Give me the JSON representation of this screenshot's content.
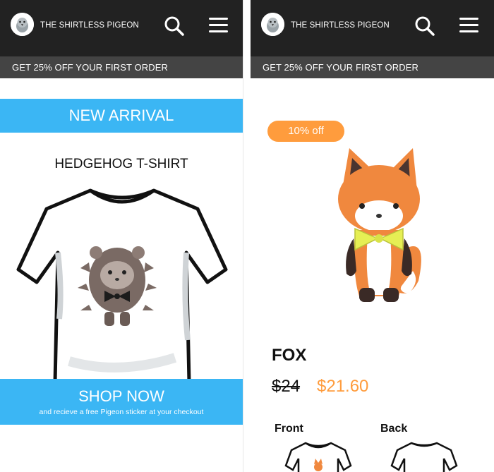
{
  "header": {
    "brand_name": "THE SHIRTLESS PIGEON",
    "search_icon": "search-icon",
    "menu_icon": "hamburger-menu-icon"
  },
  "promo": {
    "text": "GET 25% OFF YOUR FIRST ORDER"
  },
  "home": {
    "banner_label": "NEW ARRIVAL",
    "product_title": "HEDGEHOG T-SHIRT",
    "shop_label": "SHOP NOW",
    "shop_subtext": "and recieve a free Pigeon sticker at your checkout"
  },
  "product": {
    "discount_badge": "10% off",
    "name": "FOX",
    "old_price": "$24",
    "new_price": "$21.60",
    "views": [
      "Front",
      "Back"
    ]
  },
  "colors": {
    "header_bg": "#222222",
    "promo_bg": "#444444",
    "accent_blue": "#3bb6f4",
    "accent_orange": "#ff9c3d"
  }
}
